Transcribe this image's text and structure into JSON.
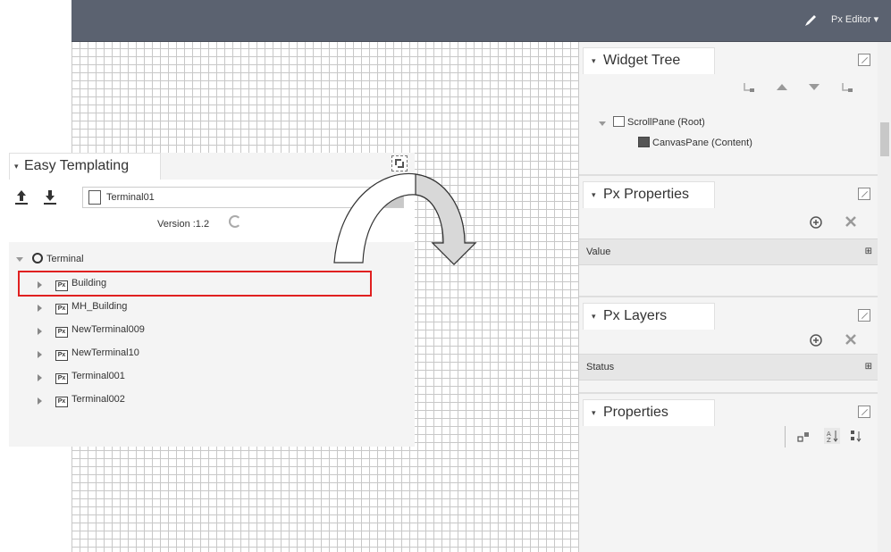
{
  "topbar": {
    "mode_label": "Px Editor ▾",
    "edit_icon": "pencil-icon"
  },
  "easy_templating": {
    "title": "Easy Templating",
    "template_select_value": "Terminal01",
    "version_label": "Version :1.2",
    "tree": {
      "root": "Terminal",
      "px_icon_text": "Px",
      "items": [
        "Building",
        "MH_Building",
        "NewTerminal009",
        "NewTerminal10",
        "Terminal001",
        "Terminal002"
      ],
      "highlighted_item": "Building"
    }
  },
  "widget_tree": {
    "title": "Widget Tree",
    "nodes": [
      {
        "label": "ScrollPane (Root)"
      },
      {
        "label": "CanvasPane (Content)"
      }
    ]
  },
  "px_properties": {
    "title": "Px Properties",
    "row_label": "Value"
  },
  "px_layers": {
    "title": "Px Layers",
    "row_label": "Status"
  },
  "properties": {
    "title": "Properties"
  },
  "colors": {
    "topbar": "#5b6270",
    "highlight": "#e02020",
    "panel_bg": "#f4f4f4"
  }
}
